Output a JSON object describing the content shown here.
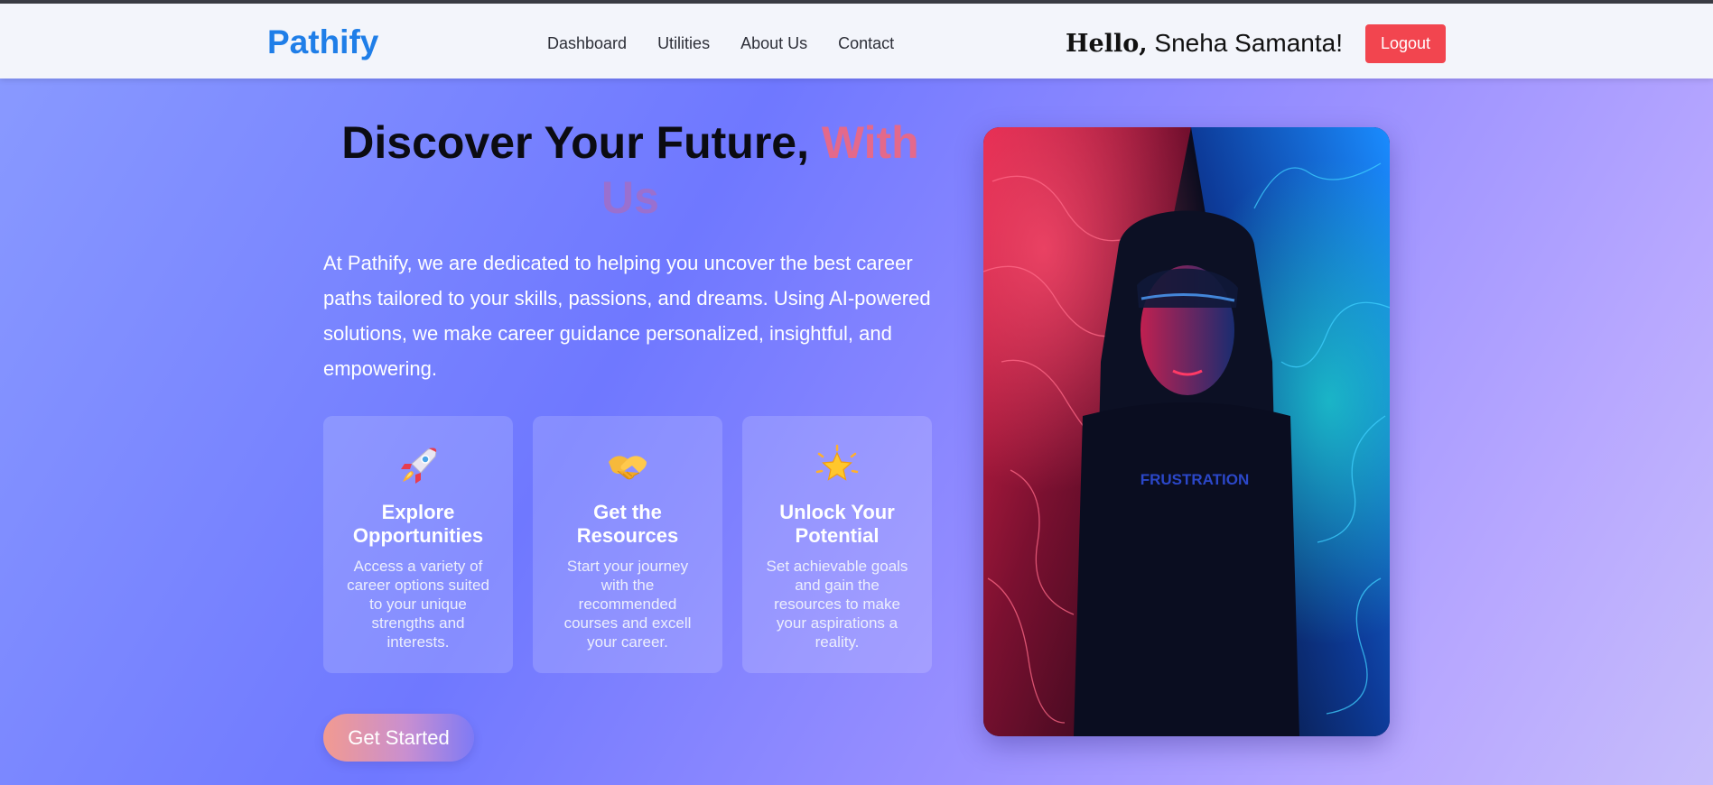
{
  "navbar": {
    "brand": "Pathify",
    "links": [
      "Dashboard",
      "Utilities",
      "About Us",
      "Contact"
    ],
    "greeting_hello": "Hello,",
    "greeting_name": "Sneha Samanta!",
    "logout_label": "Logout"
  },
  "hero": {
    "title_main": "Discover Your Future, ",
    "title_accent_1": "With",
    "title_accent_2": "Us",
    "intro": "At Pathify, we are dedicated to helping you uncover the best career paths tailored to your skills, passions, and dreams. Using AI-powered solutions, we make career guidance personalized, insightful, and empowering.",
    "cta_label": "Get Started"
  },
  "cards": [
    {
      "icon": "rocket-icon",
      "title": "Explore Opportunities",
      "description": "Access a variety of career options suited to your unique strengths and interests."
    },
    {
      "icon": "handshake-icon",
      "title": "Get the Resources",
      "description": "Start your journey with the recommended courses and excell your career."
    },
    {
      "icon": "star-icon",
      "title": "Unlock Your Potential",
      "description": "Set achievable goals and gain the resources to make your aspirations a reality."
    }
  ],
  "colors": {
    "brand": "#1f7ee8",
    "logout": "#f2454f",
    "accent_pink": "#e4698b",
    "accent_purple": "#9a70cf"
  },
  "photo_text": "FRUSTRATION"
}
